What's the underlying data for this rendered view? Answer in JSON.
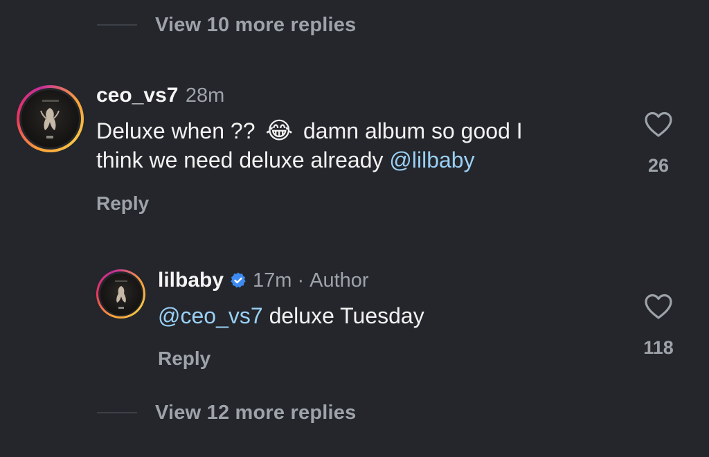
{
  "thread": {
    "view_more_top": "View 10 more replies",
    "view_more_bottom": "View 12 more replies"
  },
  "comment": {
    "username": "ceo_vs7",
    "time": "28m",
    "text_line1_a": "Deluxe when ??",
    "emoji": "😂",
    "text_line1_b": "damn album so good I",
    "text_line2_a": "think we need deluxe already",
    "mention": "@lilbaby",
    "reply_label": "Reply",
    "likes": "26",
    "heart_icon": "heart-outline-icon"
  },
  "reply": {
    "username": "lilbaby",
    "verified_icon": "verified-badge-icon",
    "time": "17m",
    "separator": "·",
    "author_label": "Author",
    "mention": "@ceo_vs7",
    "text": "deluxe Tuesday",
    "reply_label": "Reply",
    "likes": "118",
    "heart_icon": "heart-outline-icon"
  },
  "colors": {
    "background": "#24262b",
    "muted": "#9ea3aa",
    "mention": "#9ad0f5",
    "verified": "#3d8bf2"
  }
}
